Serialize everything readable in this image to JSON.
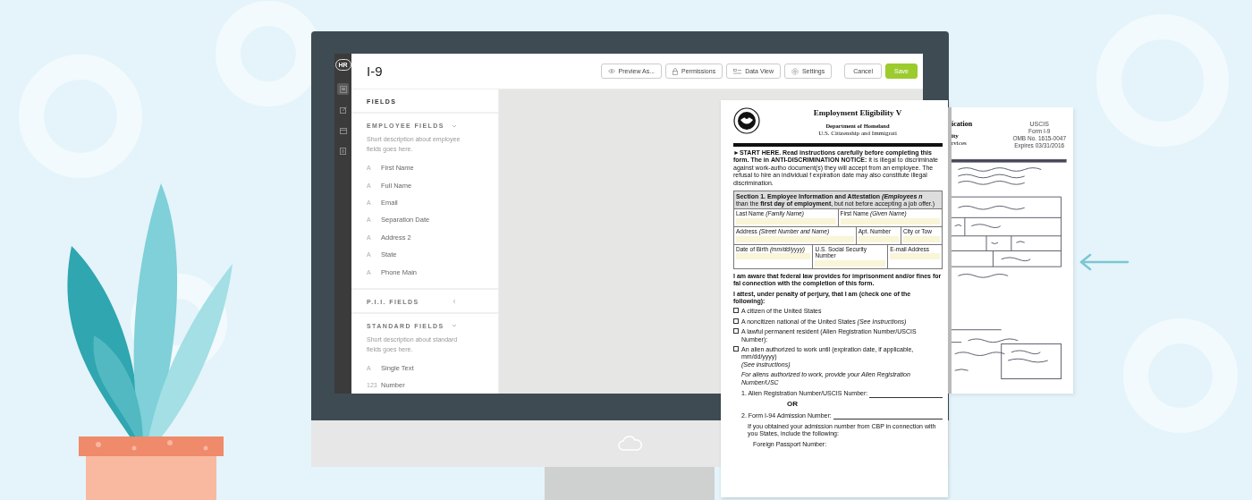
{
  "app": {
    "logo": "HR",
    "rail": [
      {
        "kind": "layout",
        "selected": true
      },
      {
        "kind": "edit",
        "selected": false
      },
      {
        "kind": "calendar",
        "selected": false
      },
      {
        "kind": "document",
        "selected": false
      }
    ],
    "title": "I-9",
    "toolbar": [
      {
        "kind": "eye",
        "label": "Preview As..."
      },
      {
        "kind": "lock",
        "label": "Permissions"
      },
      {
        "kind": "list",
        "label": "Data View"
      },
      {
        "kind": "gear",
        "label": "Settings"
      }
    ],
    "actions": [
      {
        "kind": "secondary",
        "label": "Cancel"
      },
      {
        "kind": "primary",
        "label": "Save"
      }
    ],
    "sidebar": {
      "heading": "FIELDS",
      "sections": [
        {
          "title": "EMPLOYEE FIELDS",
          "expanded": true,
          "description": "Short description about employee fields goes here.",
          "items": [
            {
              "type": "A",
              "label": "First Name"
            },
            {
              "type": "A",
              "label": "Full Name"
            },
            {
              "type": "A",
              "label": "Email"
            },
            {
              "type": "A",
              "label": "Separation Date"
            },
            {
              "type": "A",
              "label": "Address 2"
            },
            {
              "type": "A",
              "label": "State"
            },
            {
              "type": "A",
              "label": "Phone Main"
            }
          ]
        },
        {
          "title": "P.I.I. FIELDS",
          "expanded": false
        },
        {
          "title": "STANDARD FIELDS",
          "expanded": true,
          "description": "Short description about standard fields goes here.",
          "items": [
            {
              "type": "A",
              "label": "Single Text"
            },
            {
              "type": "123",
              "label": "Number"
            }
          ]
        }
      ]
    }
  },
  "document": {
    "title": "Employment Eligibility V",
    "department": "Department of Homeland",
    "agency": "U.S. Citizenship and Immigrati",
    "notice": "**►START HERE.** **Read instructions carefully before completing this form. The in** **ANTI-DISCRIMINATION NOTICE:** It is illegal to discriminate against work-autho document(s) they will accept from an employee. The refusal to hire an individual f expiration date may also constitute illegal discrimination.",
    "section_title": "Section 1. Employee Information and Attestation *(Employees n*",
    "section_note": "than the **first day of employment**, but not before accepting a job offer.)",
    "form_rows": [
      [
        "Last Name *(Family Name)*",
        "First Name *(Given Name)*"
      ],
      [
        "Address *(Street Number and Name)*",
        "Apt. Number",
        "City or Tow"
      ],
      [
        "Date of Birth *(mm/dd/yyyy)*",
        "U.S. Social Security Number",
        "E-mail Address"
      ]
    ],
    "awareness": "I am aware that federal law provides for imprisonment and/or fines for fal connection with the completion of this form.",
    "attest": "I attest, under penalty of perjury, that I am (check one of the following):",
    "options": [
      {
        "label": "A citizen of the United States",
        "checked": false
      },
      {
        "label": "A noncitizen national of the United States *(See Instructions)*",
        "checked": false
      },
      {
        "label": "A lawful permanent resident (Alien Registration Number/USCIS Number):",
        "checked": false
      },
      {
        "label": "An alien authorized to work until (expiration date, if applicable, mm/dd/yyyy)",
        "note": "(See instructions)",
        "checked": false
      }
    ],
    "aliens_note": "For aliens authorized to work, provide your Alien Registration Number/USC",
    "numbered": [
      {
        "label": "1. Alien Registration Number/USCIS Number:"
      },
      {
        "label": "OR",
        "kind": "divider"
      },
      {
        "label": "2. Form I-94 Admission Number:"
      }
    ],
    "cbp_note": "If you obtained your admission number from CBP in connection with you States, include the following:",
    "passport": "Foreign Passport Number:"
  },
  "sketch": {
    "title_end": "ication",
    "department_end": "ity",
    "agency_end": "rvices",
    "agency_lines": [
      "USCIS",
      "Form I-9",
      "OMB No. 1615-0047",
      "Expires 03/31/2016"
    ]
  }
}
